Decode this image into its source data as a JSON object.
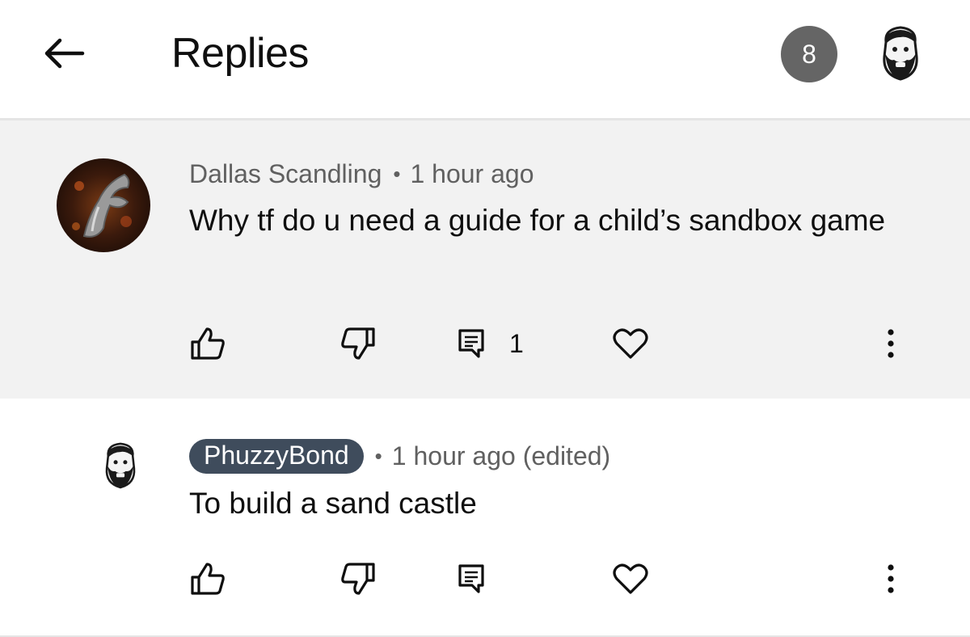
{
  "header": {
    "title": "Replies",
    "notification_count": "8",
    "back_icon": "arrow-left-icon",
    "account_icon": "bearded-avatar-icon"
  },
  "comment": {
    "author": "Dallas Scandling",
    "separator": "•",
    "time": "1 hour ago",
    "text": "Why tf do u need a guide for a child’s sandbox game",
    "reply_count": "1",
    "icons": [
      "thumbs-up-icon",
      "thumbs-down-icon",
      "reply-icon",
      "heart-icon",
      "more-vertical-icon"
    ]
  },
  "reply": {
    "author": "PhuzzyBond",
    "separator": "•",
    "time": "1 hour ago (edited)",
    "text": "To build a sand castle",
    "icons": [
      "thumbs-up-icon",
      "thumbs-down-icon",
      "reply-icon",
      "heart-icon",
      "more-vertical-icon"
    ]
  },
  "colors": {
    "comment_background": "#f2f2f2",
    "badge_background": "#656565",
    "author_chip_background": "#3f4c5c",
    "meta_text": "#606060"
  }
}
